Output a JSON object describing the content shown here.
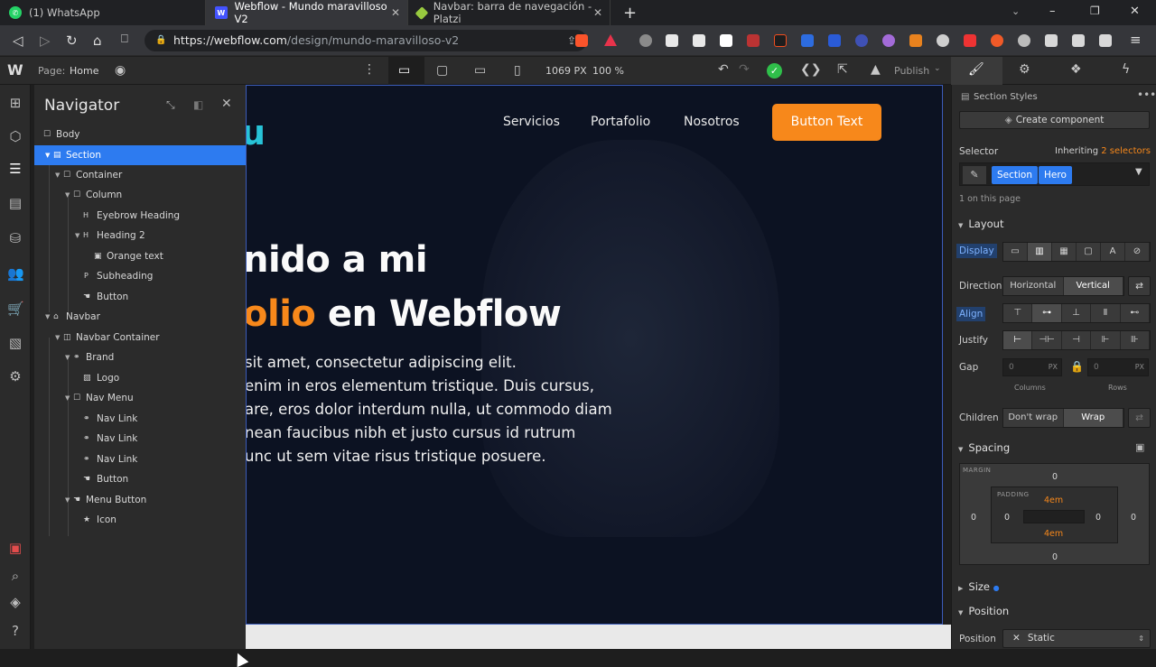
{
  "browser": {
    "tabs": [
      {
        "label": "(1) WhatsApp",
        "favicon": "whatsapp-icon",
        "color": "#25d366"
      },
      {
        "label": "Webflow - Mundo maravilloso V2",
        "favicon": "webflow-icon",
        "color": "#4353ff",
        "active": true
      },
      {
        "label": "Navbar: barra de navegación - Platzi",
        "favicon": "platzi-icon",
        "color": "#98ca3f"
      }
    ],
    "new_tab": "+",
    "url_host": "https://webflow.com",
    "url_path": "/design/mundo-maravilloso-v2"
  },
  "topbar": {
    "page_label": "Page:",
    "page_name": "Home",
    "width_px": "1069 PX",
    "zoom": "100 %",
    "publish": "Publish"
  },
  "navigator": {
    "title": "Navigator",
    "items": [
      {
        "label": "Body",
        "icon": "box-icon"
      },
      {
        "label": "Section",
        "icon": "section-icon"
      },
      {
        "label": "Container",
        "icon": "box-icon"
      },
      {
        "label": "Column",
        "icon": "box-icon"
      },
      {
        "label": "Eyebrow Heading",
        "icon": "heading-icon"
      },
      {
        "label": "Heading 2",
        "icon": "heading-icon"
      },
      {
        "label": "Orange text",
        "icon": "text-icon"
      },
      {
        "label": "Subheading",
        "icon": "paragraph-icon"
      },
      {
        "label": "Button",
        "icon": "hand-icon"
      },
      {
        "label": "Navbar",
        "icon": "home-icon"
      },
      {
        "label": "Navbar Container",
        "icon": "container-icon"
      },
      {
        "label": "Brand",
        "icon": "link-icon"
      },
      {
        "label": "Logo",
        "icon": "image-icon"
      },
      {
        "label": "Nav Menu",
        "icon": "box-icon"
      },
      {
        "label": "Nav Link",
        "icon": "link-icon"
      },
      {
        "label": "Nav Link",
        "icon": "link-icon"
      },
      {
        "label": "Nav Link",
        "icon": "link-icon"
      },
      {
        "label": "Button",
        "icon": "hand-icon"
      },
      {
        "label": "Menu Button",
        "icon": "hand-icon"
      },
      {
        "label": "Icon",
        "icon": "star-icon"
      }
    ]
  },
  "canvas": {
    "brand_fragment": "u",
    "nav_links": [
      "Servicios",
      "Portafolio",
      "Nosotros"
    ],
    "cta": "Button Text",
    "heading_line1": "nido a mi",
    "heading_orange": "olio",
    "heading_rest": " en Webflow",
    "paragraph": [
      "sit amet, consectetur adipiscing elit.",
      "enim in eros elementum tristique. Duis cursus,",
      "are, eros dolor interdum nulla, ut commodo diam",
      "nean faucibus nibh et justo cursus id rutrum",
      "unc ut sem vitae risus tristique posuere."
    ],
    "accent": "#f7881b"
  },
  "style_panel": {
    "section_styles": "Section Styles",
    "create_component": "Create component",
    "selector_label": "Selector",
    "inheriting_prefix": "Inheriting",
    "inheriting_link": "2 selectors",
    "chips": [
      "Section",
      "Hero"
    ],
    "on_page": "1 on this page",
    "layout": "Layout",
    "display": "Display",
    "direction": "Direction",
    "horizontal": "Horizontal",
    "vertical": "Vertical",
    "align": "Align",
    "justify": "Justify",
    "gap": "Gap",
    "gap_col": "0",
    "gap_row": "0",
    "px": "PX",
    "columns": "Columns",
    "rows": "Rows",
    "children": "Children",
    "dont_wrap": "Don't wrap",
    "wrap": "Wrap",
    "spacing": "Spacing",
    "margin_tag": "MARGIN",
    "padding_tag": "PADDING",
    "margin": {
      "top": "0",
      "right": "0",
      "bottom": "0",
      "left": "0"
    },
    "padding": {
      "top": "4em",
      "right": "0",
      "bottom": "4em",
      "left": "0"
    },
    "size": "Size",
    "position_section": "Position",
    "position_label": "Position",
    "position_value": "Static"
  }
}
